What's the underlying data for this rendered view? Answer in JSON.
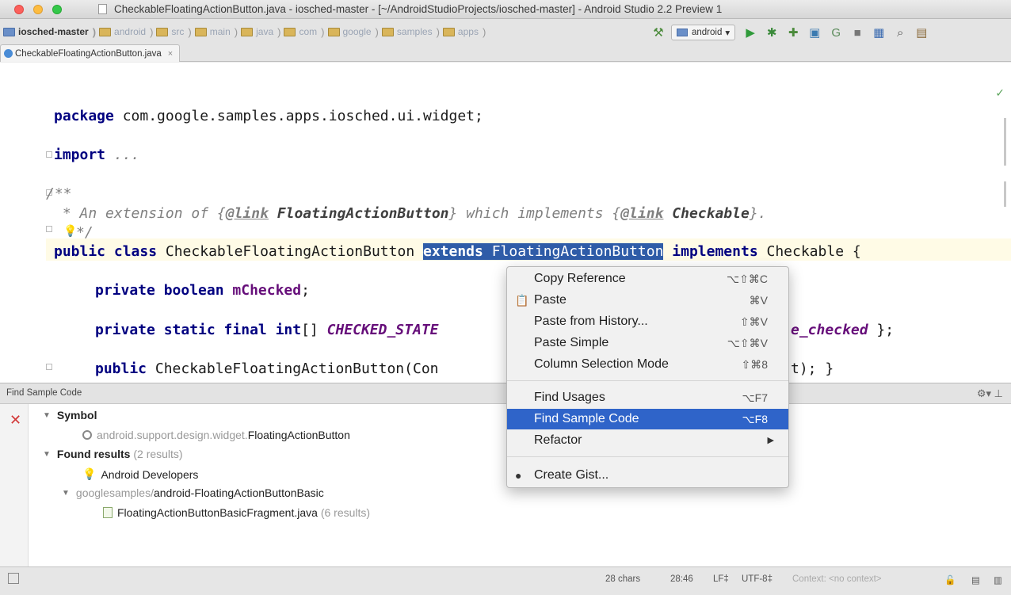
{
  "window": {
    "title": "CheckableFloatingActionButton.java - iosched-master - [~/AndroidStudioProjects/iosched-master] - Android Studio 2.2 Preview 1"
  },
  "breadcrumbs": [
    "iosched-master",
    "android",
    "src",
    "main",
    "java",
    "com",
    "google",
    "samples",
    "apps"
  ],
  "toolbar": {
    "run_config": "android"
  },
  "tabs": [
    {
      "label": "CheckableFloatingActionButton.java",
      "close": "×"
    }
  ],
  "editor": {
    "lines": {
      "package_kw": "package",
      "package_name": " com.google.samples.apps.iosched.ui.widget;",
      "import_kw": "import",
      "import_rest": " ...",
      "doc_open": "/**",
      "doc_pre": " * An extension of {",
      "doc_link_tag": "@link",
      "doc_class1": " FloatingActionButton",
      "doc_mid": "} which implements {",
      "doc_link_tag2": "@link",
      "doc_class2": " Checkable",
      "doc_end": "}.",
      "doc_close": "*/",
      "class_public": "public class",
      "class_name": " CheckableFloatingActionButton ",
      "class_extends": "extends",
      "class_super": " FloatingActionButton",
      "class_implements": "implements",
      "class_rest": " Checkable {",
      "field1_kw": "private boolean",
      "field1_name": " mChecked",
      "field1_end": ";",
      "field2_kw": "private static final int",
      "field2_mid": "[] ",
      "field2_const": "CHECKED_STATE",
      "field2_tail": "e_checked",
      "field2_end": " };",
      "ctor_kw": "public",
      "ctor_rest": " CheckableFloatingActionButton(Con",
      "ctor_tail": "t); }"
    }
  },
  "context_menu": {
    "items": [
      {
        "label": "Copy Reference",
        "shortcut": "⌥⇧⌘C",
        "icon": ""
      },
      {
        "label": "Paste",
        "shortcut": "⌘V",
        "icon": "paste-icon"
      },
      {
        "label": "Paste from History...",
        "shortcut": "⇧⌘V",
        "icon": ""
      },
      {
        "label": "Paste Simple",
        "shortcut": "⌥⇧⌘V",
        "icon": ""
      },
      {
        "label": "Column Selection Mode",
        "shortcut": "⇧⌘8",
        "icon": ""
      },
      {
        "label": "Find Usages",
        "shortcut": "⌥F7",
        "icon": ""
      },
      {
        "label": "Find Sample Code",
        "shortcut": "⌥F8",
        "icon": ""
      },
      {
        "label": "Refactor",
        "shortcut": "",
        "icon": ""
      },
      {
        "label": "Create Gist...",
        "shortcut": "",
        "icon": "github-icon"
      }
    ],
    "active": "Find Sample Code"
  },
  "find_panel": {
    "title": "Find Sample Code",
    "symbol_label": "Symbol",
    "symbol_pkg": "android.support.design.widget.",
    "symbol_class": "FloatingActionButton",
    "found_label": "Found results",
    "found_count": "(2 results)",
    "provider": "Android Developers",
    "repo_prefix": "googlesamples/",
    "repo_name": "android-FloatingActionButtonBasic",
    "file_name": "FloatingActionButtonBasicFragment.java",
    "file_count": "(6 results)"
  },
  "status_bar": {
    "chars": "28 chars",
    "position": "28:46",
    "line_sep": "LF‡",
    "encoding": "UTF-8‡",
    "context": "Context: <no context>"
  },
  "colors": {
    "selection": "#2f5ca8",
    "menu_active": "#2f64c9",
    "keyword": "#000080"
  }
}
